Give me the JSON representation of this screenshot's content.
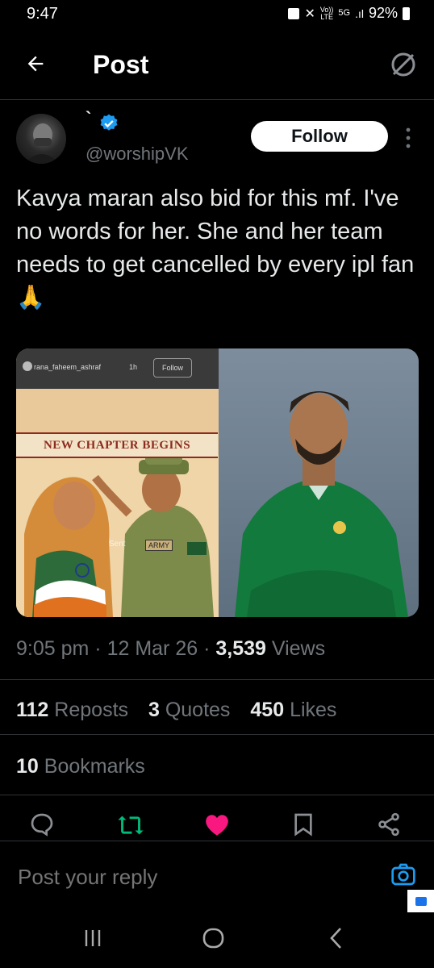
{
  "status_bar": {
    "time": "9:47",
    "network": "5G",
    "volte": "Vo))\nLTE",
    "battery": "92%"
  },
  "header": {
    "title": "Post"
  },
  "post": {
    "author": {
      "display_name": "`",
      "handle": "@worshipVK",
      "verified": true
    },
    "follow_label": "Follow",
    "text": "Kavya maran also bid for this mf. I've no words for her. She and her team needs to get cancelled by every ipl fan 🙏",
    "media": {
      "left_image": {
        "ig_username": "rana_faheem_ashraf",
        "ig_time": "1h",
        "ig_follow": "Follow",
        "banner_text": "NEW CHAPTER BEGINS",
        "sent_label": "Sent",
        "army_label": "ARMY"
      }
    },
    "time": "9:05 pm",
    "date": "12 Mar 26",
    "views_count": "3,539",
    "views_label": "Views",
    "reposts_count": "112",
    "reposts_label": "Reposts",
    "quotes_count": "3",
    "quotes_label": "Quotes",
    "likes_count": "450",
    "likes_label": "Likes",
    "bookmarks_count": "10",
    "bookmarks_label": "Bookmarks"
  },
  "reply": {
    "placeholder": "Post your reply"
  },
  "colors": {
    "accent": "#1d9bf0",
    "like": "#f91880",
    "repost": "#00ba7c",
    "muted": "#71767b"
  },
  "icons": [
    "back-arrow-icon",
    "sparkle-icon",
    "verified-icon",
    "more-vertical-icon",
    "reply-icon",
    "repost-icon",
    "like-icon",
    "bookmark-icon",
    "share-icon",
    "camera-icon",
    "recents-icon",
    "home-icon",
    "back-nav-icon"
  ]
}
